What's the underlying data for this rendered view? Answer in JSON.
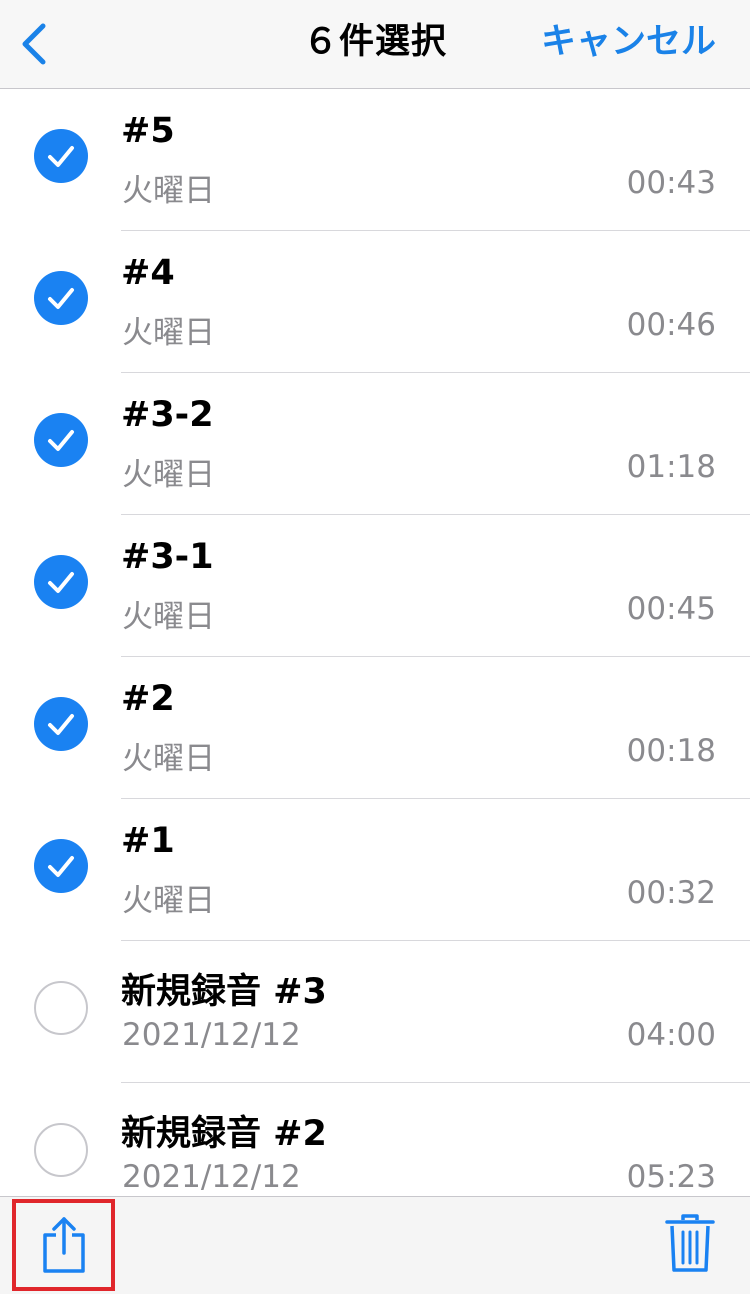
{
  "navbar": {
    "back_icon": "chevron-left-icon",
    "title": "６件選択",
    "cancel_label": "キャンセル"
  },
  "recordings": [
    {
      "title": "#5",
      "date": "火曜日",
      "duration": "00:43",
      "selected": true
    },
    {
      "title": "#4",
      "date": "火曜日",
      "duration": "00:46",
      "selected": true
    },
    {
      "title": "#3-2",
      "date": "火曜日",
      "duration": "01:18",
      "selected": true
    },
    {
      "title": "#3-1",
      "date": "火曜日",
      "duration": "00:45",
      "selected": true
    },
    {
      "title": "#2",
      "date": "火曜日",
      "duration": "00:18",
      "selected": true
    },
    {
      "title": "#1",
      "date": "火曜日",
      "duration": "00:32",
      "selected": true
    },
    {
      "title": "新規録音 #3",
      "date": "2021/12/12",
      "duration": "04:00",
      "selected": false
    },
    {
      "title": "新規録音 #2",
      "date": "2021/12/12",
      "duration": "05:23",
      "selected": false
    }
  ],
  "toolbar": {
    "share_icon": "share-icon",
    "trash_icon": "trash-icon"
  },
  "colors": {
    "accent": "#1a82f2",
    "highlight_border": "#e0262b",
    "secondary_text": "#8a8a8e"
  }
}
